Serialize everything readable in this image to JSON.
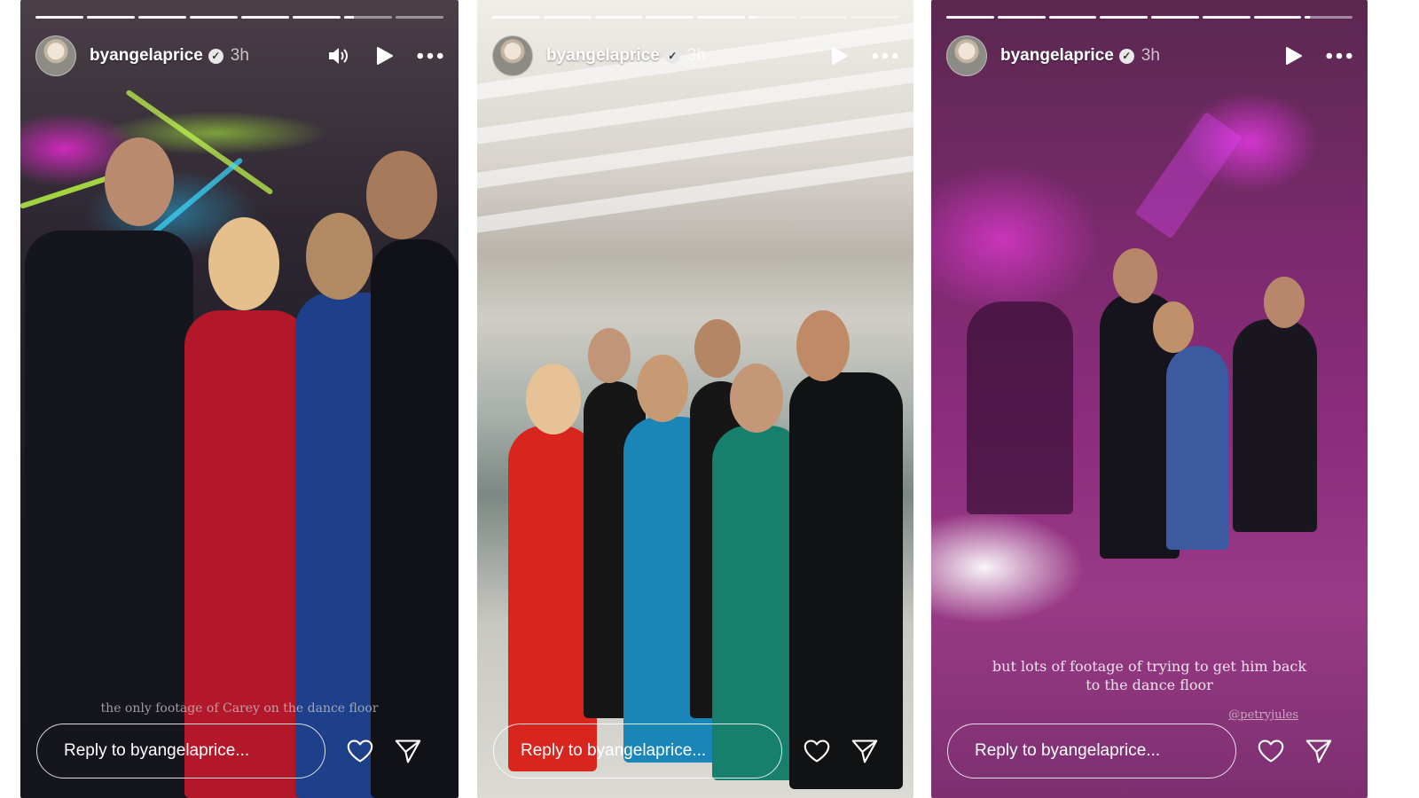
{
  "stories": [
    {
      "username": "byangelaprice",
      "time": "3h",
      "progress": {
        "segments": 8,
        "completed": 6,
        "current_fraction": 0.2
      },
      "caption": "the only footage of Carey on the dance floor",
      "reply_placeholder": "Reply to byangelaprice...",
      "icons": [
        "avatar",
        "verified-icon",
        "volume-icon",
        "play-icon",
        "more-icon",
        "heart-icon",
        "send-icon"
      ]
    },
    {
      "username": "byangelaprice",
      "time": "3h",
      "progress": {
        "segments": 8,
        "completed": 5,
        "current_fraction": 0.15
      },
      "reply_placeholder": "Reply to byangelaprice...",
      "icons": [
        "avatar",
        "verified-icon",
        "play-icon",
        "more-icon",
        "heart-icon",
        "send-icon"
      ]
    },
    {
      "username": "byangelaprice",
      "time": "3h",
      "progress": {
        "segments": 8,
        "completed": 7,
        "current_fraction": 0.1
      },
      "caption_line1": "but lots of footage of trying to get him back",
      "caption_line2": "to the dance floor",
      "mention": "@petryjules",
      "reply_placeholder": "Reply to byangelaprice...",
      "icons": [
        "avatar",
        "verified-icon",
        "play-icon",
        "more-icon",
        "heart-icon",
        "send-icon"
      ]
    }
  ],
  "colors": {
    "overlay_text": "#ffffff",
    "reply_border": "#ffffff"
  }
}
